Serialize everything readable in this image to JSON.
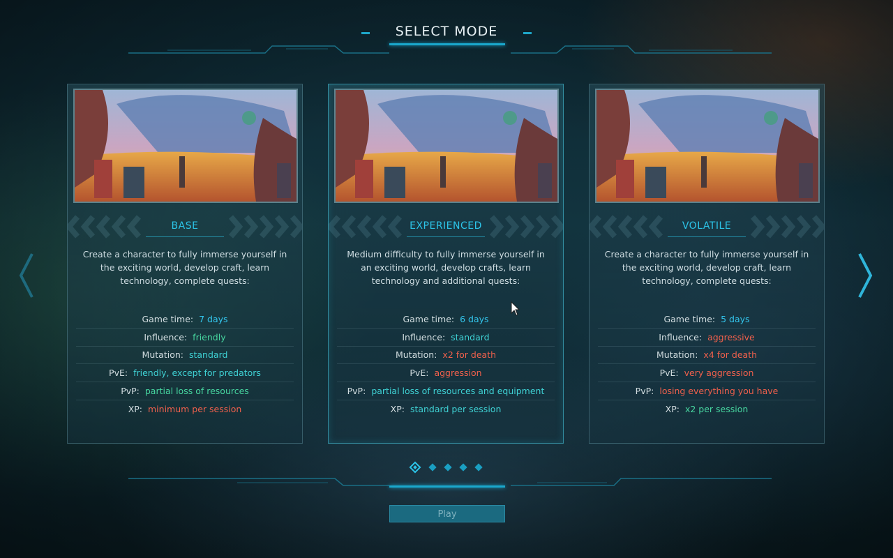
{
  "header": {
    "title": "SELECT MODE"
  },
  "colors": {
    "accent": "#2cc4e8",
    "green": "#47d6a0",
    "red": "#f0604c",
    "button": "#1b6a80"
  },
  "modes": [
    {
      "name": "BASE",
      "description": "Create a character to fully immerse yourself in the exciting world, develop craft, learn technology, complete quests:",
      "stats": [
        {
          "label": "Game time:",
          "value": "7 days",
          "tone": "blue"
        },
        {
          "label": "Influence:",
          "value": "friendly",
          "tone": "green"
        },
        {
          "label": "Mutation:",
          "value": "standard",
          "tone": "teal"
        },
        {
          "label": "PvE:",
          "value": "friendly, except for predators",
          "tone": "teal"
        },
        {
          "label": "PvP:",
          "value": "partial loss of resources",
          "tone": "green"
        },
        {
          "label": "XP:",
          "value": "minimum per session",
          "tone": "red"
        }
      ]
    },
    {
      "name": "EXPERIENCED",
      "description": "Medium difficulty to fully immerse yourself in an exciting world, develop crafts, learn technology and additional quests:",
      "stats": [
        {
          "label": "Game time:",
          "value": "6 days",
          "tone": "blue"
        },
        {
          "label": "Influence:",
          "value": "standard",
          "tone": "teal"
        },
        {
          "label": "Mutation:",
          "value": "x2 for death",
          "tone": "red"
        },
        {
          "label": "PvE:",
          "value": "aggression",
          "tone": "red"
        },
        {
          "label": "PvP:",
          "value": "partial loss of resources and equipment",
          "tone": "teal"
        },
        {
          "label": "XP:",
          "value": "standard per session",
          "tone": "teal"
        }
      ]
    },
    {
      "name": "VOLATILE",
      "description": "Create a character to fully immerse yourself in the exciting world, develop craft, learn technology, complete quests:",
      "stats": [
        {
          "label": "Game time:",
          "value": "5 days",
          "tone": "blue"
        },
        {
          "label": "Influence:",
          "value": "aggressive",
          "tone": "red"
        },
        {
          "label": "Mutation:",
          "value": "x4 for death",
          "tone": "red"
        },
        {
          "label": "PvE:",
          "value": "very aggression",
          "tone": "red"
        },
        {
          "label": "PvP:",
          "value": "losing everything you have",
          "tone": "red"
        },
        {
          "label": "XP:",
          "value": "x2 per session",
          "tone": "green"
        }
      ]
    }
  ],
  "pager": {
    "current": 1,
    "total": 5
  },
  "play": {
    "label": "Play"
  }
}
